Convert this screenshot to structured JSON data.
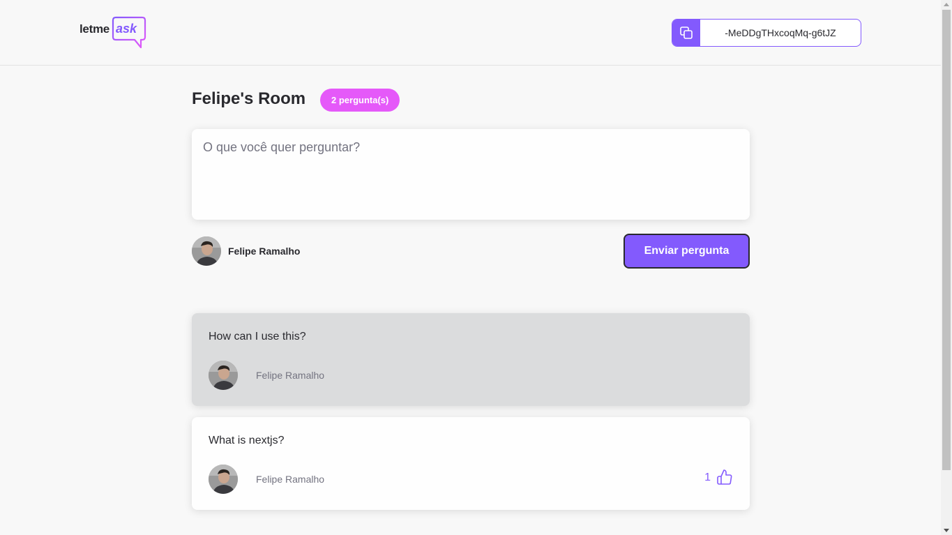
{
  "header": {
    "logo_part1": "letme",
    "logo_part2": "ask",
    "room_code": "-MeDDgTHxcoqMq-g6tJZ"
  },
  "room": {
    "title": "Felipe's Room",
    "question_count": "2 pergunta(s)"
  },
  "form": {
    "placeholder": "O que você quer perguntar?",
    "user_name": "Felipe Ramalho",
    "submit_label": "Enviar pergunta"
  },
  "questions": [
    {
      "content": "How can I use this?",
      "author": "Felipe Ramalho",
      "highlighted": true
    },
    {
      "content": "What is nextjs?",
      "author": "Felipe Ramalho",
      "highlighted": false,
      "likes": "1"
    }
  ],
  "colors": {
    "accent": "#835afd",
    "badge": "#e559f9",
    "highlight_bg": "#dbdcdd",
    "text": "#29292e",
    "muted": "#737380"
  },
  "icons": {
    "copy": "copy-icon",
    "like": "thumbs-up-icon"
  }
}
